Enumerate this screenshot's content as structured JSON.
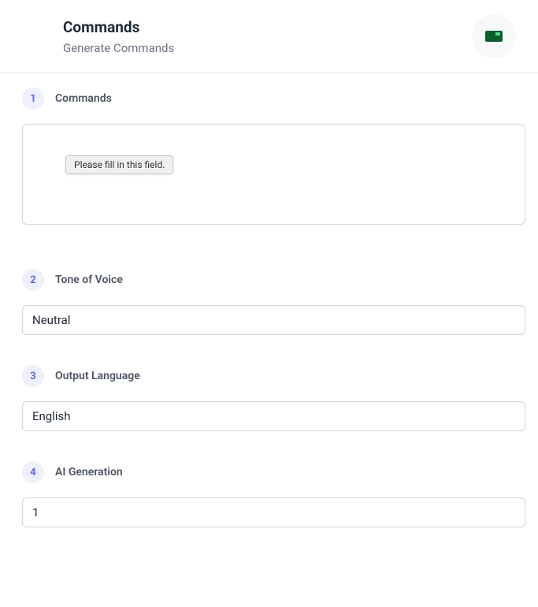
{
  "header": {
    "title": "Commands",
    "subtitle": "Generate Commands"
  },
  "sections": {
    "commands": {
      "step": "1",
      "label": "Commands",
      "validation_message": "Please fill in this field."
    },
    "tone": {
      "step": "2",
      "label": "Tone of Voice",
      "value": "Neutral"
    },
    "language": {
      "step": "3",
      "label": "Output Language",
      "value": "English"
    },
    "generation": {
      "step": "4",
      "label": "AI Generation",
      "value": "1"
    }
  }
}
